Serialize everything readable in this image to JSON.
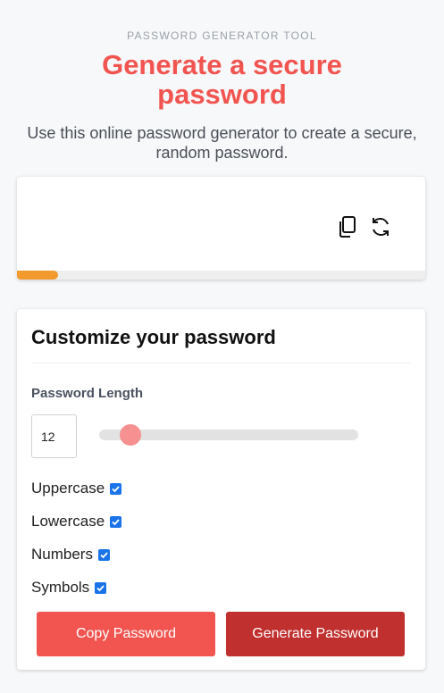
{
  "header": {
    "eyebrow": "PASSWORD GENERATOR TOOL",
    "title": "Generate a secure password",
    "subtitle": "Use this online password generator to create a secure, random password."
  },
  "output": {
    "password": "",
    "strength_fraction": 0.1,
    "icons": {
      "copy": "copy-icon",
      "refresh": "refresh-icon"
    },
    "colors": {
      "strength": "#f29a2e"
    }
  },
  "customize": {
    "title": "Customize your password",
    "length_label": "Password Length",
    "length_value": "12",
    "slider_fraction": 0.12,
    "options": [
      {
        "label": "Uppercase",
        "checked": true
      },
      {
        "label": "Lowercase",
        "checked": true
      },
      {
        "label": "Numbers",
        "checked": true
      },
      {
        "label": "Symbols",
        "checked": true
      }
    ]
  },
  "buttons": {
    "copy_label": "Copy Password",
    "generate_label": "Generate Password"
  },
  "colors": {
    "accent": "#f25550",
    "generate": "#c0302e",
    "checkbox": "#1a73e8",
    "slider_thumb": "#f79090"
  }
}
